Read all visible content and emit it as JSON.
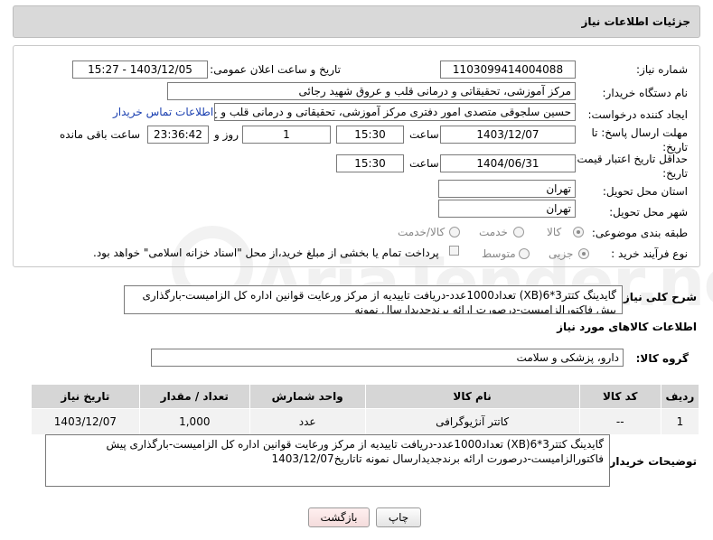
{
  "header": {
    "title": "جزئیات اطلاعات نیاز"
  },
  "fields": {
    "need_number_label": "شماره نیاز:",
    "need_number": "1103099414004088",
    "announce_label": "تاریخ و ساعت اعلان عمومی:",
    "announce_value": "1403/12/05 - 15:27",
    "buyer_label": "نام دستگاه خریدار:",
    "buyer_value": "مرکز آموزشی، تحقیقاتی و درمانی قلب و عروق شهید رجائی",
    "creator_label": "ایجاد کننده درخواست:",
    "creator_value": "حسین سلجوقی متصدی امور دفتری مرکز آموزشی، تحقیقاتی و درمانی قلب و ع",
    "contact_link": "اطلاعات تماس خریدار",
    "deadline_label": "مهلت ارسال پاسخ: تا تاریخ:",
    "deadline_date": "1403/12/07",
    "time_label": "ساعت",
    "deadline_time": "15:30",
    "days_value": "1",
    "days_label": "روز و",
    "remaining_time": "23:36:42",
    "remaining_label": "ساعت باقی مانده",
    "validity_label": "حداقل تاریخ اعتبار قیمت: تا تاریخ:",
    "validity_date": "1404/06/31",
    "validity_time": "15:30",
    "province_label": "استان محل تحویل:",
    "province_value": "تهران",
    "city_label": "شهر محل تحویل:",
    "city_value": "تهران",
    "category_label": "طبقه بندی موضوعی:",
    "category_options": [
      "کالا",
      "خدمت",
      "کالا/خدمت"
    ],
    "process_label": "نوع فرآیند خرید :",
    "process_options": [
      "جزیی",
      "متوسط"
    ],
    "payment_note": "پرداخت تمام یا بخشی از مبلغ خرید،از محل \"اسناد خزانه اسلامی\" خواهد بود."
  },
  "summary": {
    "label": "شرح کلی نیاز:",
    "text": "گایدینگ کتتر3*6(XB) تعداد1000عدد-دریافت تاییدیه از مرکز ورعایت قوانین اداره کل الزامیست-بارگذاری پیش فاکتورالزامیست-درصورت ارائه برندجدیدارسال نمونه"
  },
  "goods": {
    "section_title": "اطلاعات کالاهای مورد نیاز",
    "group_label": "گروه کالا:",
    "group_value": "دارو، پزشکی و سلامت",
    "columns": [
      "ردیف",
      "کد کالا",
      "نام کالا",
      "واحد شمارش",
      "تعداد / مقدار",
      "تاریخ نیاز"
    ],
    "rows": [
      {
        "row": "1",
        "code": "--",
        "name": "کاتتر آنژیوگرافی",
        "unit": "عدد",
        "qty": "1,000",
        "date": "1403/12/07"
      }
    ]
  },
  "buyer_notes": {
    "label": "توضیحات خریدار:",
    "text": "گایدینگ کتتر3*6(XB) تعداد1000عدد-دریافت تاییدیه از مرکز ورعایت قوانین اداره کل الزامیست-بارگذاری پیش فاکتورالزامیست-درصورت ارائه برندجدیدارسال نمونه تاتاریخ1403/12/07"
  },
  "buttons": {
    "print": "چاپ",
    "back": "بازگشت"
  },
  "watermark": {
    "text": "AriaTender.neT"
  }
}
